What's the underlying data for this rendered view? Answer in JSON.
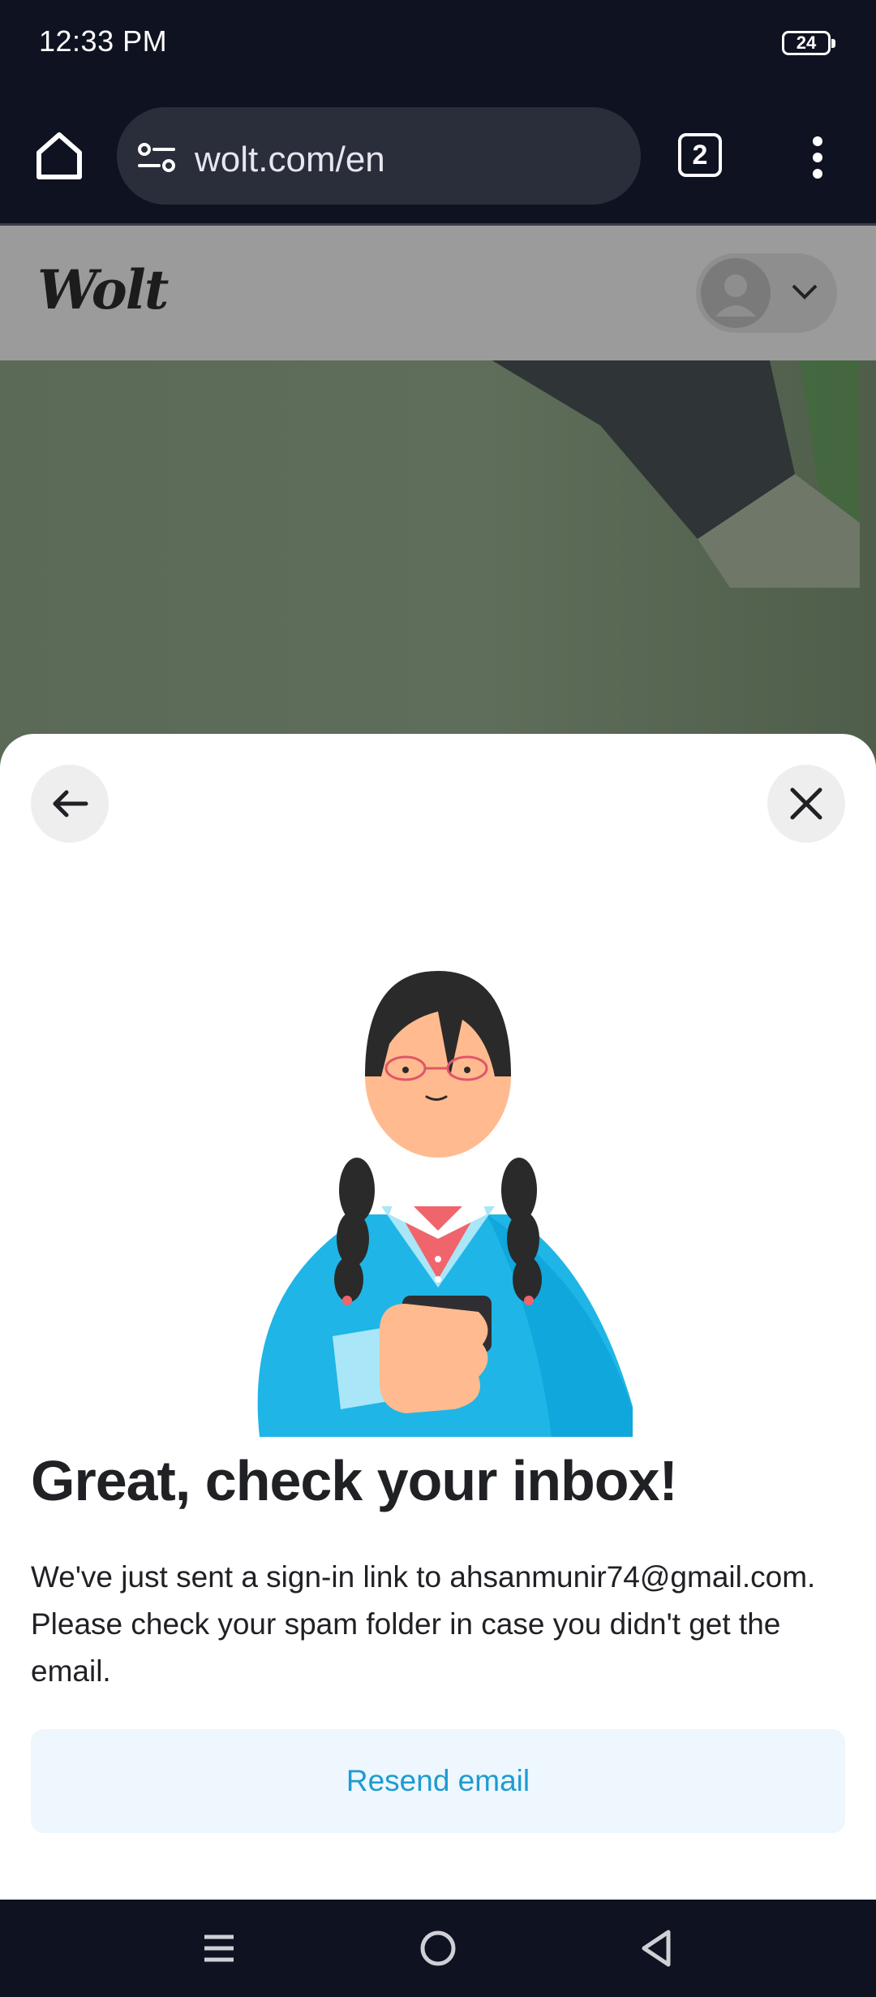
{
  "status_bar": {
    "time": "12:33 PM",
    "battery": "24"
  },
  "browser": {
    "url": "wolt.com/en",
    "tab_count": "2",
    "icons": [
      "home-icon",
      "site-settings-icon",
      "tabs-icon",
      "more-vert-icon"
    ]
  },
  "page": {
    "logo": "Wolt",
    "icons": [
      "avatar-icon",
      "chevron-down-icon"
    ]
  },
  "sheet": {
    "title": "Great, check your inbox!",
    "message": "We've just sent a sign-in link to ahsanmunir74@gmail.com. Please check your spam folder in case you didn't get the email.",
    "resend_label": "Resend email",
    "icons": [
      "arrow-back-icon",
      "close-icon"
    ]
  },
  "nav_bar": {
    "icons": [
      "recents-icon",
      "home-circle-icon",
      "back-triangle-icon"
    ]
  },
  "colors": {
    "system_bar": "#0f1220",
    "url_bar": "#2a2d3a",
    "accent": "#1e9bd1",
    "button_bg": "#edf7fd",
    "text": "#202125"
  }
}
